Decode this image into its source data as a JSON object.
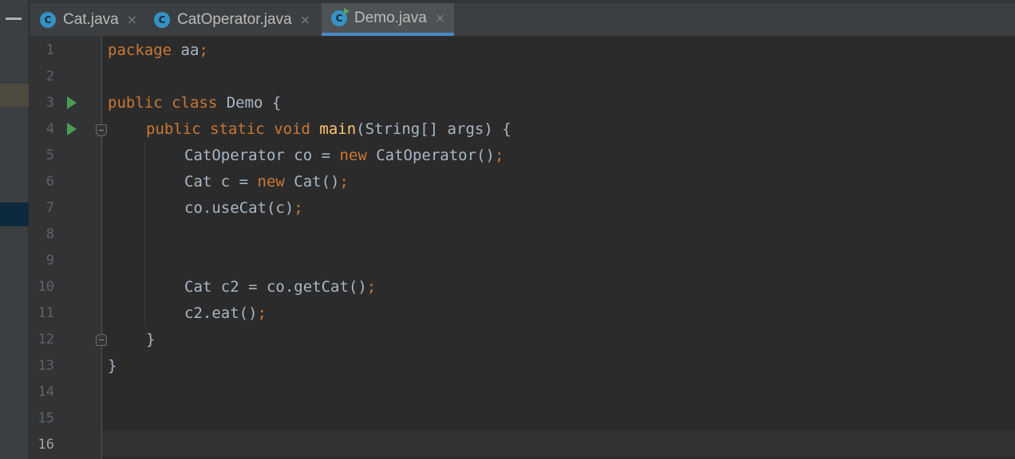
{
  "tabs": [
    {
      "label": "Cat.java",
      "icon_letter": "C",
      "close": "×",
      "active": false
    },
    {
      "label": "CatOperator.java",
      "icon_letter": "C",
      "close": "×",
      "active": false
    },
    {
      "label": "Demo.java",
      "icon_letter": "C",
      "close": "×",
      "active": true
    }
  ],
  "editor": {
    "line_numbers": [
      "1",
      "2",
      "3",
      "4",
      "5",
      "6",
      "7",
      "8",
      "9",
      "10",
      "11",
      "12",
      "13",
      "14",
      "15",
      "16"
    ],
    "current_line": "16",
    "run_lines": [
      "3",
      "4"
    ],
    "code": {
      "l1": {
        "kw": "package",
        "rest": " aa",
        "semi": ";"
      },
      "l3": {
        "kw1": "public",
        "kw2": "class",
        "rest": " Demo {"
      },
      "l4": {
        "kw1": "public",
        "kw2": "static",
        "kw3": "void",
        "fn": "main",
        "rest": "(String[] args) {"
      },
      "l5": {
        "pre": "CatOperator co = ",
        "kw": "new",
        "rest": " CatOperator()",
        "semi": ";"
      },
      "l6": {
        "pre": "Cat c = ",
        "kw": "new",
        "rest": " Cat()",
        "semi": ";"
      },
      "l7": {
        "pre": "co.useCat(c)",
        "semi": ";"
      },
      "l10": {
        "pre": "Cat c2 = co.getCat()",
        "semi": ";"
      },
      "l11": {
        "pre": "c2.eat()",
        "semi": ";"
      },
      "l12": {
        "pre": "}"
      },
      "l13": {
        "pre": "}"
      }
    }
  },
  "colors": {
    "keyword": "#cc7832",
    "method": "#ffc66d",
    "text": "#a9b7c6",
    "background": "#2b2b2b",
    "tab_accent": "#4a88c7",
    "run_icon": "#499c54"
  }
}
